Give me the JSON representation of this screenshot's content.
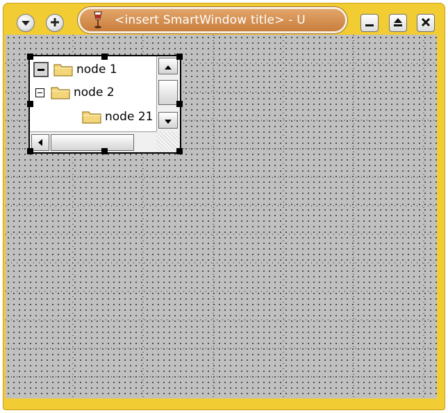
{
  "window": {
    "title": "<insert SmartWindow title> - U",
    "icons": {
      "menu": "chevron-down-circle-icon",
      "add": "plus-circle-icon",
      "app": "wine-glass-icon",
      "minimize": "minimize-icon",
      "maximize": "maximize-icon",
      "close": "close-icon"
    },
    "colors": {
      "frame": "#f2cc33",
      "title_pill": "#d08a4a",
      "canvas": "#c0c0c0"
    }
  },
  "tree": {
    "nodes": [
      {
        "label": "node 1",
        "expander": "collapsed"
      },
      {
        "label": "node 2",
        "expander": "expanded"
      },
      {
        "label": "node 21"
      }
    ]
  }
}
